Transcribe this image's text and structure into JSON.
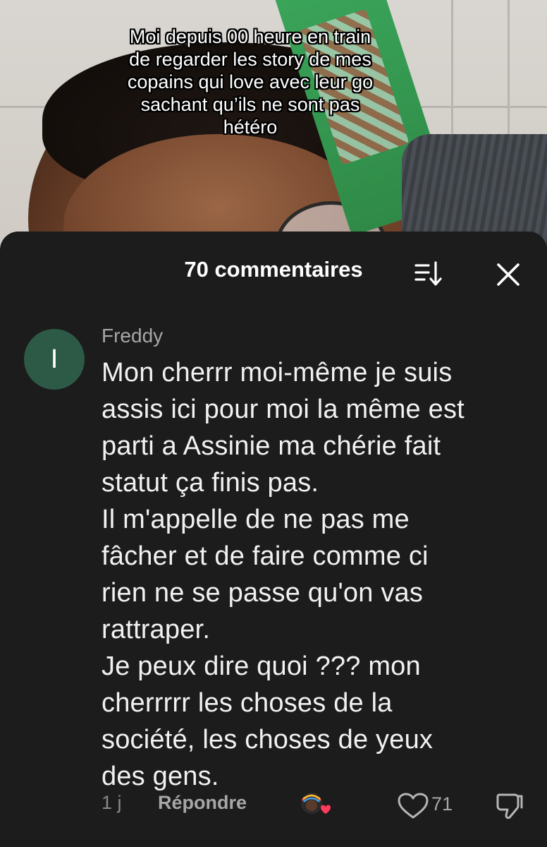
{
  "video": {
    "caption": "Moi depuis 00 heure en train\nde regarder les story de mes\ncopains qui love avec leur go\nsachant qu’ils ne sont pas\nhétéro"
  },
  "comments_panel": {
    "count_label": "70 commentaires",
    "sort_icon": "sort-icon",
    "close_icon": "close-icon"
  },
  "comment": {
    "avatar_initial": "I",
    "avatar_color": "#2c5a47",
    "username": "Freddy",
    "text": "Mon cherrr moi-même je suis\nassis ici pour moi la même est\nparti a Assinie ma chérie fait\nstatut ça finis pas.\nIl m'appelle de ne pas me\nfâcher et de faire comme ci\nrien ne se passe qu'on vas\nrattraper.\nJe peux dire quoi ??? mon\ncherrrrr les choses de la\nsociété, les choses de yeux\ndes gens.",
    "time": "1 j",
    "reply_label": "Répondre",
    "creator_liked_icon": "creator-liked-avatar-icon",
    "like_icon": "heart-icon",
    "like_count": "71",
    "dislike_icon": "thumbs-down-icon"
  }
}
